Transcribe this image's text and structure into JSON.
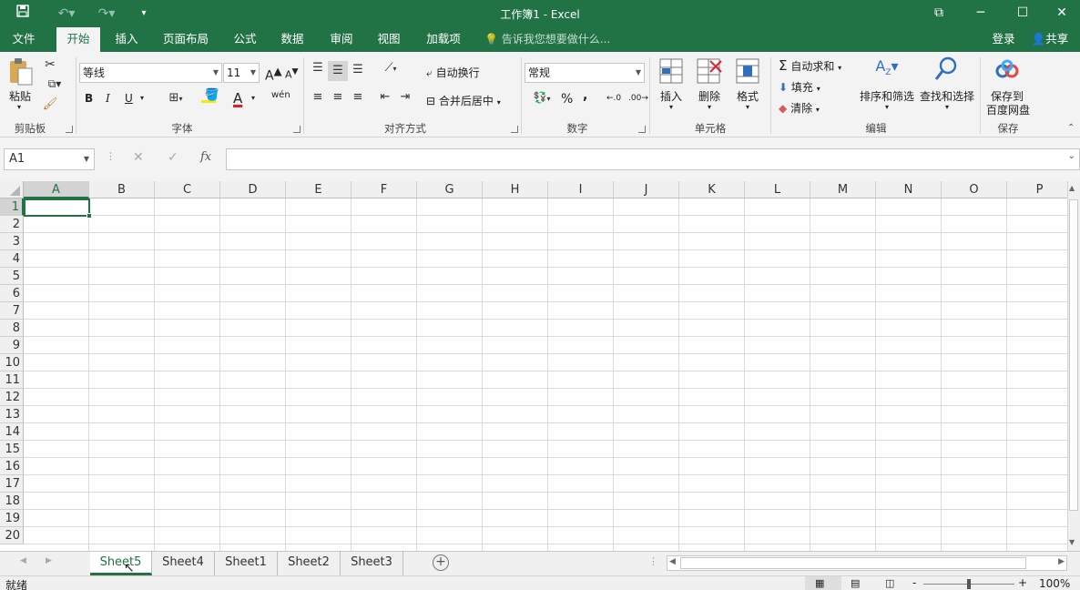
{
  "window": {
    "title": "工作簿1 - Excel",
    "minimize_glyph": "─",
    "maximize_glyph": "☐",
    "close_glyph": "✕",
    "ribbon_display_glyph": "⧉"
  },
  "tabs": [
    {
      "label": "文件"
    },
    {
      "label": "开始"
    },
    {
      "label": "插入"
    },
    {
      "label": "页面布局"
    },
    {
      "label": "公式"
    },
    {
      "label": "数据"
    },
    {
      "label": "审阅"
    },
    {
      "label": "视图"
    },
    {
      "label": "加载项"
    }
  ],
  "tell_me": "告诉我您想要做什么...",
  "account": {
    "login": "登录",
    "share": "共享"
  },
  "ribbon": {
    "clipboard": {
      "paste": "粘贴",
      "group": "剪贴板"
    },
    "font": {
      "name": "等线",
      "size": "11",
      "group": "字体",
      "bold": "B",
      "italic": "I",
      "underline": "U",
      "grow": "A",
      "shrink": "A",
      "font_color": "A",
      "phonetic": "wén"
    },
    "alignment": {
      "wrap": "自动换行",
      "merge": "合并后居中",
      "group": "对齐方式"
    },
    "number": {
      "format": "常规",
      "percent": "%",
      "comma": ",",
      "inc_decimal": ".00",
      "dec_decimal": ".0",
      "group": "数字"
    },
    "cells": {
      "insert": "插入",
      "delete": "删除",
      "format": "格式",
      "group": "单元格"
    },
    "editing": {
      "autosum": "自动求和",
      "fill": "填充",
      "clear": "清除",
      "sort": "排序和筛选",
      "find": "查找和选择",
      "group": "编辑"
    },
    "save": {
      "label1": "保存到",
      "label2": "百度网盘",
      "group": "保存"
    }
  },
  "formula_bar": {
    "name_box": "A1",
    "fx": "fx",
    "formula": ""
  },
  "grid": {
    "columns": [
      "A",
      "B",
      "C",
      "D",
      "E",
      "F",
      "G",
      "H",
      "I",
      "J",
      "K",
      "L",
      "M",
      "N",
      "O",
      "P"
    ],
    "rows": [
      "1",
      "2",
      "3",
      "4",
      "5",
      "6",
      "7",
      "8",
      "9",
      "10",
      "11",
      "12",
      "13",
      "14",
      "15",
      "16",
      "17",
      "18",
      "19",
      "20"
    ],
    "selected_column": "A",
    "selected_row": "1"
  },
  "sheets": [
    {
      "name": "Sheet5",
      "active": true
    },
    {
      "name": "Sheet4",
      "active": false
    },
    {
      "name": "Sheet1",
      "active": false
    },
    {
      "name": "Sheet2",
      "active": false
    },
    {
      "name": "Sheet3",
      "active": false
    }
  ],
  "status": {
    "ready": "就绪",
    "zoom": "100%",
    "zoom_minus": "-",
    "zoom_plus": "+"
  },
  "colors": {
    "accent": "#217346",
    "ribbon_bg": "#f3f3f3"
  }
}
